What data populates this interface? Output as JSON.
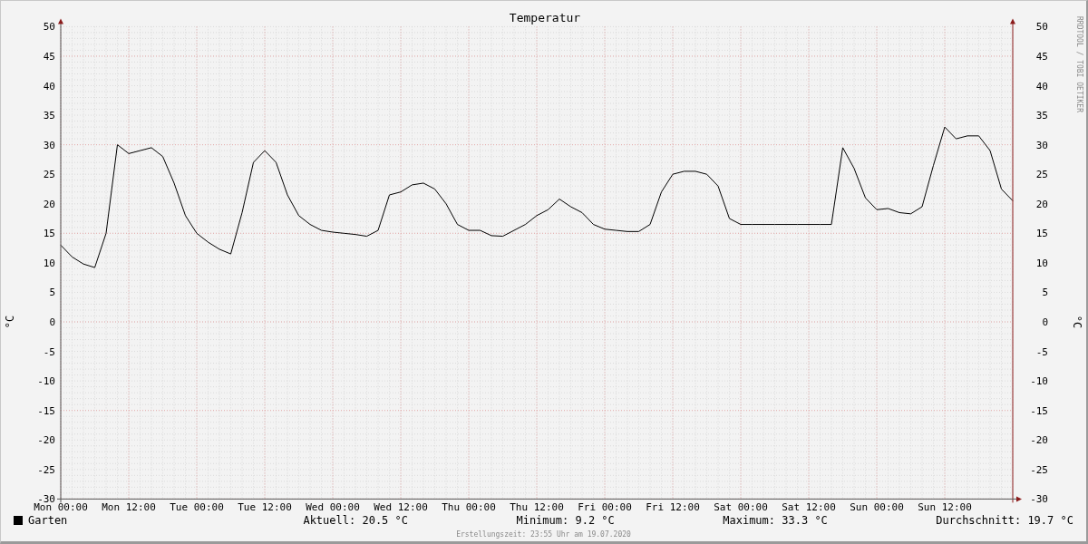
{
  "chart_data": {
    "type": "line",
    "grid": true,
    "title": "Temperatur",
    "ylabel": "°C",
    "ylim": [
      -30,
      50
    ],
    "categories": [
      "Mon 00:00",
      null,
      null,
      null,
      null,
      null,
      "Mon 12:00",
      null,
      null,
      null,
      null,
      null,
      "Tue 00:00",
      null,
      null,
      null,
      null,
      null,
      "Tue 12:00",
      null,
      null,
      null,
      null,
      null,
      "Wed 00:00",
      null,
      null,
      null,
      null,
      null,
      "Wed 12:00",
      null,
      null,
      null,
      null,
      null,
      "Thu 00:00",
      null,
      null,
      null,
      null,
      null,
      "Thu 12:00",
      null,
      null,
      null,
      null,
      null,
      "Fri 00:00",
      null,
      null,
      null,
      null,
      null,
      "Fri 12:00",
      null,
      null,
      null,
      null,
      null,
      "Sat 00:00",
      null,
      null,
      null,
      null,
      null,
      "Sat 12:00",
      null,
      null,
      null,
      null,
      null,
      "Sun 00:00",
      null,
      null,
      null,
      null,
      null,
      "Sun 12:00",
      null,
      null,
      null,
      null,
      null,
      null
    ],
    "yticks": [
      -30,
      -25,
      -20,
      -15,
      -10,
      -5,
      0,
      5,
      10,
      15,
      20,
      25,
      30,
      35,
      40,
      45,
      50
    ],
    "series": [
      {
        "name": "Garten",
        "color": "#000000",
        "values": [
          13,
          11,
          9.8,
          9.2,
          15,
          30,
          28.5,
          29,
          29.5,
          28,
          23.5,
          18,
          15,
          13.5,
          12.3,
          11.5,
          18.5,
          27,
          29,
          27,
          21.5,
          18,
          16.5,
          15.5,
          15.2,
          15,
          14.8,
          14.5,
          15.5,
          21.5,
          22,
          23.2,
          23.5,
          22.5,
          20,
          16.5,
          15.5,
          15.5,
          14.6,
          14.5,
          15.5,
          16.5,
          18,
          19,
          20.8,
          19.5,
          18.5,
          16.5,
          15.7,
          15.5,
          15.3,
          15.3,
          16.5,
          22,
          25,
          25.5,
          25.5,
          25,
          23,
          17.5,
          16.5,
          16.5,
          16.5,
          16.5,
          16.5,
          16.5,
          16.5,
          16.5,
          16.5,
          29.5,
          26,
          21,
          19,
          19.2,
          18.5,
          18.3,
          19.5,
          26.5,
          33,
          31,
          31.5,
          31.5,
          29,
          22.5,
          20.5
        ]
      }
    ]
  },
  "right_axis_label": "°C",
  "right_yticks": [
    "50",
    "45",
    "40",
    "35",
    "30",
    "25",
    "20",
    "15",
    "10",
    "5",
    "0",
    "-5",
    "-10",
    "-15",
    "-20",
    "-25",
    "-30"
  ],
  "credit": "RRDTOOL / TOBI OETIKER",
  "stats": [
    "Aktuell: 20.5 °C",
    "Minimum: 9.2 °C",
    "Maximum: 33.3 °C",
    "Durchschnitt: 19.7 °C"
  ],
  "footer": "Erstellungszeit: 23:55 Uhr am 19.07.2020"
}
